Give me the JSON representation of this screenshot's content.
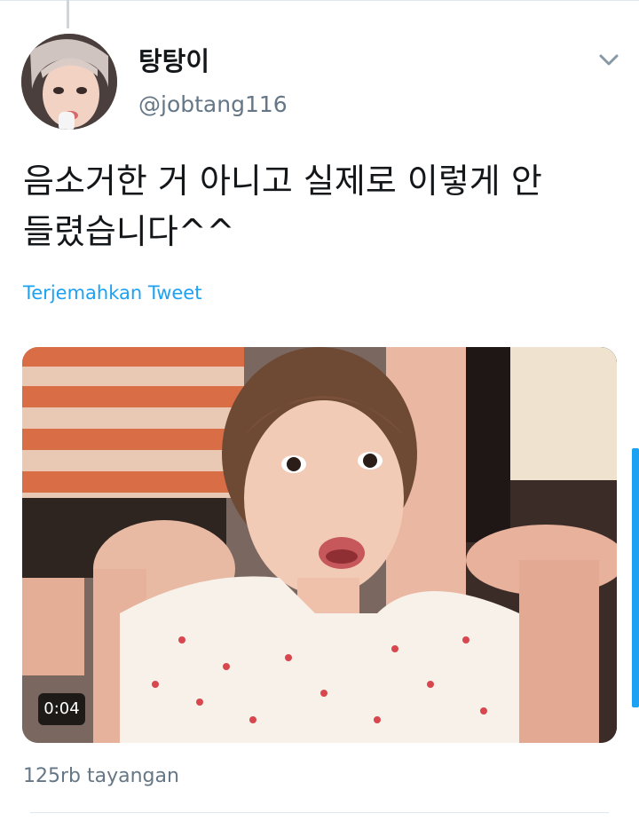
{
  "tweet": {
    "author": {
      "display_name": "탕탕이",
      "handle": "@jobtang116"
    },
    "text": "음소거한 거 아니고 실제로 이렇게 안\n들렸습니다^^",
    "translate_label": "Terjemahkan Tweet",
    "media": {
      "duration": "0:04"
    },
    "views_label": "125rb tayangan"
  },
  "colors": {
    "link": "#1da1f2",
    "secondary_text": "#657786",
    "divider": "#e1e8ed"
  },
  "icons": {
    "menu": "chevron-down-icon"
  }
}
